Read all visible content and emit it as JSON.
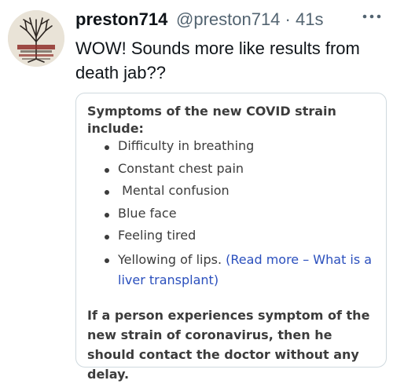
{
  "tweet": {
    "display_name": "preston714",
    "handle": "@preston714",
    "separator": "·",
    "time": "41s",
    "more_icon": "ellipsis-icon",
    "text": "WOW!  Sounds more like results from death jab??",
    "avatar": {
      "lettering": [
        "THE TREE",
        "LIBERTY",
        "BLOOD"
      ]
    }
  },
  "card": {
    "heading": "Symptoms of the new COVID strain include:",
    "items": [
      {
        "text": "Difficulty in breathing"
      },
      {
        "text": "Constant chest pain"
      },
      {
        "text": " Mental confusion"
      },
      {
        "text": "Blue face"
      },
      {
        "text": "Feeling tired"
      },
      {
        "text": "Yellowing of lips.",
        "link": "(Read more – What is a liver transplant)"
      }
    ],
    "footer": "If a person experiences symptom of the new strain of coronavirus, then he should contact the doctor without any delay."
  },
  "colors": {
    "text": "#0f1419",
    "secondary": "#536471",
    "card_text": "#3c3c3c",
    "link": "#2a4fbd",
    "border": "#cfd9de"
  }
}
